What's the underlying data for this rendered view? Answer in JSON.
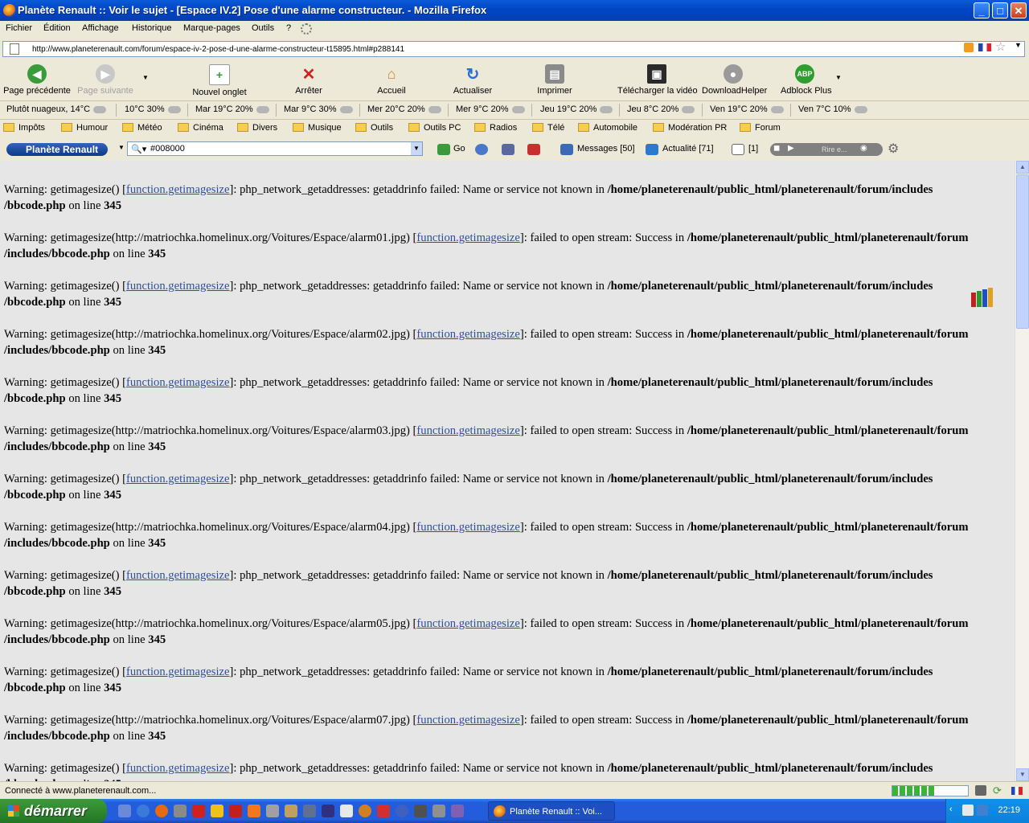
{
  "window": {
    "title": "Planète Renault :: Voir le sujet - [Espace IV.2] Pose d'une alarme constructeur. - Mozilla Firefox",
    "minimize": "_",
    "maximize": "□",
    "close": "✕"
  },
  "menu": [
    "Fichier",
    "Édition",
    "Affichage",
    "Historique",
    "Marque-pages",
    "Outils",
    "?"
  ],
  "address": {
    "url": "http://www.planeterenault.com/forum/espace-iv-2-pose-d-une-alarme-constructeur-t15895.html#p288141"
  },
  "nav": {
    "back": "Page précédente",
    "forward": "Page suivante",
    "new_tab": "Nouvel onglet",
    "stop": "Arrêter",
    "home": "Accueil",
    "reload": "Actualiser",
    "print": "Imprimer",
    "download_video": "Télécharger la vidéo",
    "downloadhelper": "DownloadHelper",
    "adblock": "Adblock Plus",
    "adblock_icon_text": "ABP"
  },
  "weather": [
    "Plutôt nuageux, 14°C",
    "10°C 30%",
    "Mar 19°C 20%",
    "Mar 9°C 30%",
    "Mer 20°C 20%",
    "Mer 9°C 20%",
    "Jeu 19°C 20%",
    "Jeu 8°C 20%",
    "Ven 19°C 20%",
    "Ven 7°C 10%"
  ],
  "bookmarks": [
    "Impôts",
    "Humour",
    "Météo",
    "Cinéma",
    "Divers",
    "Musique",
    "Outils",
    "Outils PC",
    "Radios",
    "Télé",
    "Automobile",
    "Modération PR",
    "Forum"
  ],
  "pr_toolbar": {
    "brand": "Planète Renault",
    "search_value": "#008000",
    "go": "Go",
    "messages": "Messages [50]",
    "actualite": "Actualité [71]",
    "mail_count": "[1]",
    "media_text": "Rire e..."
  },
  "warnings": {
    "label": "Warning",
    "link": "function.getimagesize",
    "line_label": "on line",
    "line_number": "345",
    "path_a1": "/home/planeterenault/public_html/planeterenault/forum/includes",
    "path_a2": "/bbcode.php",
    "path_b1": "/home/planeterenault/public_html/planeterenault/forum",
    "path_b2": "/includes/bbcode.php",
    "items": [
      {
        "call": "getimagesize()",
        "msg": "php_network_getaddresses: getaddrinfo failed: Name or service not known in"
      },
      {
        "call": "getimagesize(http://matriochka.homelinux.org/Voitures/Espace/alarm01.jpg)",
        "msg": "failed to open stream: Success in"
      },
      {
        "call": "getimagesize()",
        "msg": "php_network_getaddresses: getaddrinfo failed: Name or service not known in"
      },
      {
        "call": "getimagesize(http://matriochka.homelinux.org/Voitures/Espace/alarm02.jpg)",
        "msg": "failed to open stream: Success in"
      },
      {
        "call": "getimagesize()",
        "msg": "php_network_getaddresses: getaddrinfo failed: Name or service not known in"
      },
      {
        "call": "getimagesize(http://matriochka.homelinux.org/Voitures/Espace/alarm03.jpg)",
        "msg": "failed to open stream: Success in"
      },
      {
        "call": "getimagesize()",
        "msg": "php_network_getaddresses: getaddrinfo failed: Name or service not known in"
      },
      {
        "call": "getimagesize(http://matriochka.homelinux.org/Voitures/Espace/alarm04.jpg)",
        "msg": "failed to open stream: Success in"
      },
      {
        "call": "getimagesize()",
        "msg": "php_network_getaddresses: getaddrinfo failed: Name or service not known in"
      },
      {
        "call": "getimagesize(http://matriochka.homelinux.org/Voitures/Espace/alarm05.jpg)",
        "msg": "failed to open stream: Success in"
      },
      {
        "call": "getimagesize()",
        "msg": "php_network_getaddresses: getaddrinfo failed: Name or service not known in"
      },
      {
        "call": "getimagesize(http://matriochka.homelinux.org/Voitures/Espace/alarm07.jpg)",
        "msg": "failed to open stream: Success in"
      },
      {
        "call": "getimagesize()",
        "msg": "php_network_getaddresses: getaddrinfo failed: Name or service not known in"
      }
    ]
  },
  "status": {
    "message": "Connecté à www.planeterenault.com...",
    "progress_fraction": 0.55
  },
  "taskbar": {
    "start": "démarrer",
    "task": "Planète Renault :: Voi...",
    "clock": "22:19"
  },
  "colors": {
    "link": "#2a4fa0",
    "content_bg": "#e6e6e6",
    "titlebar": "#0347c6",
    "start_button": "#2f892f"
  }
}
